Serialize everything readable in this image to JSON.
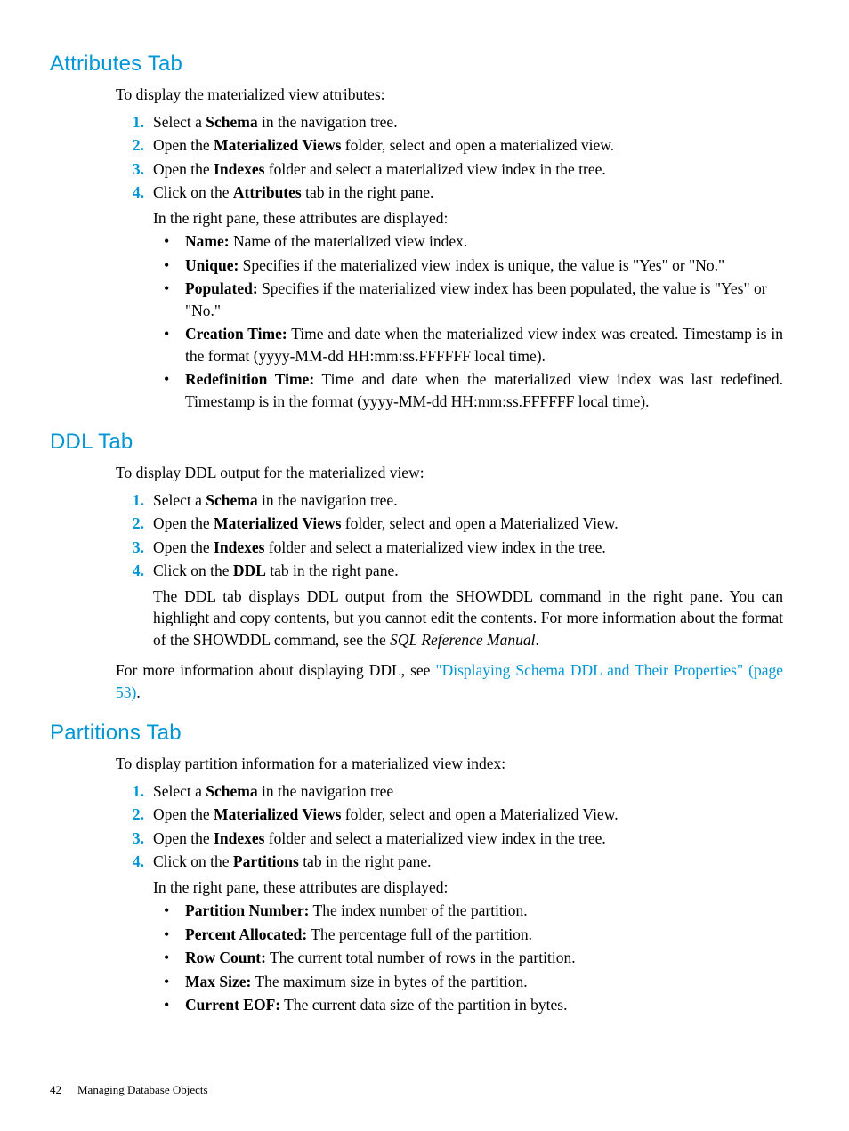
{
  "sections": {
    "attributes": {
      "heading": "Attributes Tab",
      "intro": "To display the materialized view attributes:",
      "step1_pre": "Select a  ",
      "step1_b": "Schema",
      "step1_post": " in the navigation tree.",
      "step2_pre": "Open the ",
      "step2_b": "Materialized Views",
      "step2_post": " folder, select and open a materialized view.",
      "step3_pre": "Open the ",
      "step3_b": "Indexes",
      "step3_post": " folder and select a materialized view index in the tree.",
      "step4_pre": "Click on the ",
      "step4_b": "Attributes",
      "step4_post": " tab in the right pane.",
      "subintro": "In the right pane, these attributes are displayed:",
      "b1_label": "Name:",
      "b1_text": " Name of the materialized view index.",
      "b2_label": "Unique:",
      "b2_text": " Specifies if the materialized view index is unique, the value is \"Yes\" or \"No.\"",
      "b3_label": "Populated:",
      "b3_text": " Specifies if the materialized view index has been populated, the value is \"Yes\" or \"No.\"",
      "b4_label": "Creation Time:",
      "b4_text": " Time and date when the materialized view index was created. Timestamp is in the format (yyyy-MM-dd HH:mm:ss.FFFFFF local time).",
      "b5_label": "Redefinition Time:",
      "b5_text": " Time and date when the materialized view index was last redefined. Timestamp is in the format (yyyy-MM-dd HH:mm:ss.FFFFFF local time)."
    },
    "ddl": {
      "heading": "DDL Tab",
      "intro": "To display DDL output for the materialized view:",
      "step1_pre": "Select a ",
      "step1_b": "Schema",
      "step1_post": " in the navigation tree.",
      "step2_pre": "Open the ",
      "step2_b": "Materialized Views",
      "step2_post": " folder, select and open a Materialized View.",
      "step3_pre": "Open the ",
      "step3_b": "Indexes",
      "step3_post": " folder and select a materialized view index in the tree.",
      "step4_pre": "Click on the ",
      "step4_b": "DDL",
      "step4_post": " tab in the right pane.",
      "para_pre": "The DDL tab displays DDL output from the SHOWDDL command in the right pane. You can highlight and copy contents, but you cannot edit the contents. For more information about the format of the SHOWDDL command, see the ",
      "para_ital": "SQL Reference Manual",
      "para_post": ".",
      "after_pre": "For more information about displaying DDL, see ",
      "after_link": "\"Displaying Schema DDL and Their Properties\" (page 53)",
      "after_post": "."
    },
    "partitions": {
      "heading": "Partitions Tab",
      "intro": "To display partition information for a materialized view index:",
      "step1_pre": "Select a ",
      "step1_b": "Schema",
      "step1_post": " in the navigation tree",
      "step2_pre": "Open the ",
      "step2_b": "Materialized Views",
      "step2_post": " folder, select and open a Materialized View.",
      "step3_pre": "Open the ",
      "step3_b": "Indexes",
      "step3_post": " folder and select a materialized view index in the tree.",
      "step4_pre": "Click on the ",
      "step4_b": "Partitions",
      "step4_post": " tab in the right pane.",
      "subintro": "In the right pane, these attributes are displayed:",
      "b1_label": "Partition Number:",
      "b1_text": " The index number of the partition.",
      "b2_label": "Percent Allocated:",
      "b2_text": " The percentage full of the partition.",
      "b3_label": "Row Count:",
      "b3_text": " The current total number of rows in the partition.",
      "b4_label": "Max Size:",
      "b4_text": " The maximum size in bytes of the partition.",
      "b5_label": "Current EOF:",
      "b5_text": " The current data size of the partition in bytes."
    }
  },
  "footer": {
    "page": "42",
    "title": "Managing Database Objects"
  }
}
